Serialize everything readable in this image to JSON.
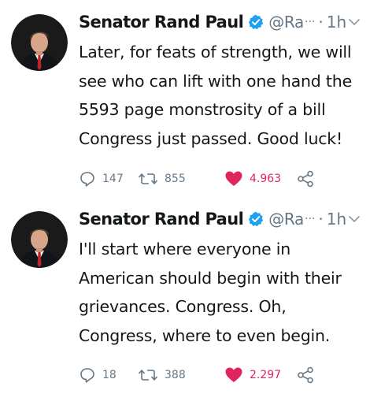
{
  "tweets": [
    {
      "author": "Senator Rand Paul",
      "handle": "@Ra",
      "time": "1h",
      "text": "Later, for feats of strength, we will see who can lift with one hand the 5593 page monstrosity of a bill Congress just passed. Good luck!",
      "replies": "147",
      "retweets": "855",
      "likes": "4.963",
      "liked": true
    },
    {
      "author": "Senator Rand Paul",
      "handle": "@Ra",
      "time": "1h",
      "text": "I'll start where everyone in American should begin with their grievances. Congress. Oh, Congress, where to even begin.",
      "replies": "18",
      "retweets": "388",
      "likes": "2.297",
      "liked": true
    }
  ],
  "icons": {
    "verified": "verified-badge-icon",
    "chevron": "chevron-down-icon",
    "reply": "reply-icon",
    "retweet": "retweet-icon",
    "like": "heart-icon",
    "share": "share-icon"
  },
  "colors": {
    "accent": "#1da1f2",
    "like": "#e0245e",
    "muted": "#657786",
    "text": "#14171a"
  }
}
